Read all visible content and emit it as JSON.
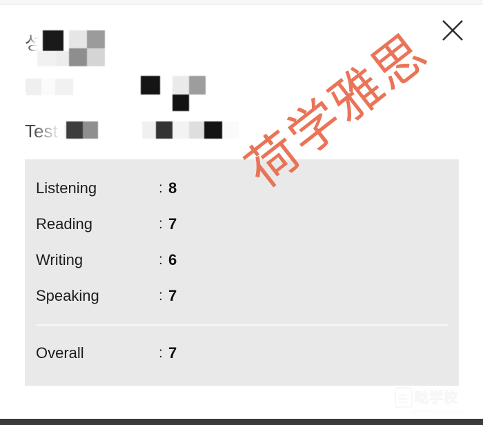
{
  "window": {
    "close_label": "×",
    "close_icon": "close-x-icon"
  },
  "header": {
    "redacted_note": "personal details obscured by mosaic/blur",
    "lines": [
      {
        "visible_text": "성",
        "legibility": "partial"
      },
      {
        "visible_text": "",
        "legibility": "blurred"
      },
      {
        "visible_text": "Test D",
        "legibility": "partial"
      }
    ]
  },
  "scores": {
    "colon": ":",
    "rows": [
      {
        "label": "Listening",
        "value": "8"
      },
      {
        "label": "Reading",
        "value": "7"
      },
      {
        "label": "Writing",
        "value": "6"
      },
      {
        "label": "Speaking",
        "value": "7"
      }
    ],
    "overall": {
      "label": "Overall",
      "value": "7"
    }
  },
  "watermarks": {
    "diagonal_text": "荷学雅思",
    "diagonal_color": "#e8694a",
    "corner_brand": "哒学校",
    "corner_url": "www.houxue.com"
  },
  "colors": {
    "panel_bg": "#e9e9e9",
    "page_bg": "#ffffff",
    "text": "#1c1c1c",
    "accent": "#e8694a",
    "bottom_bar": "#3b3b3d"
  }
}
